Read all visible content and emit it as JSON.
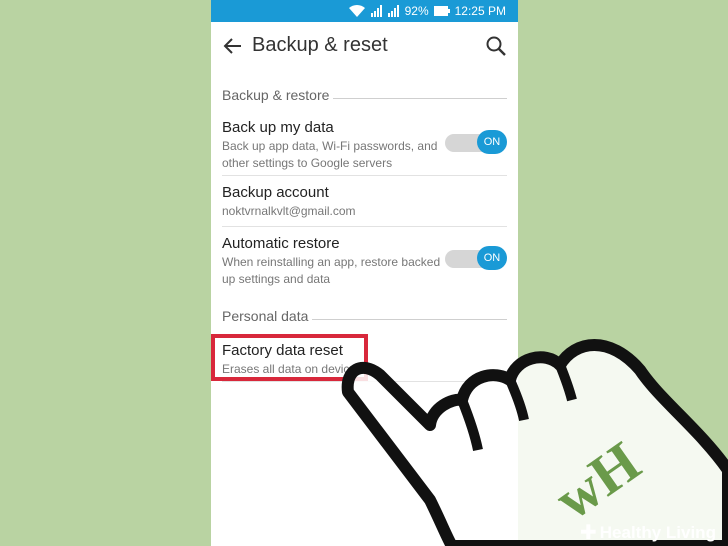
{
  "status_bar": {
    "battery": "92%",
    "time": "12:25 PM"
  },
  "app_bar": {
    "title": "Backup & reset"
  },
  "sections": {
    "backup_restore": "Backup & restore",
    "personal_data": "Personal data"
  },
  "items": {
    "back_up_my_data": {
      "title": "Back up my data",
      "subtitle": "Back up app data, Wi-Fi passwords, and other settings to Google servers",
      "toggle": "ON"
    },
    "backup_account": {
      "title": "Backup account",
      "subtitle": "noktvrnalkvlt@gmail.com"
    },
    "automatic_restore": {
      "title": "Automatic restore",
      "subtitle": "When reinstalling an app, restore backed up settings and data",
      "toggle": "ON"
    },
    "factory_data_reset": {
      "title": "Factory data reset",
      "subtitle": "Erases all data on device"
    }
  },
  "watermark": {
    "brand": "Healthy Living"
  },
  "colors": {
    "accent": "#1a9ad6",
    "highlight": "#d8283b",
    "background": "#b9d3a2"
  },
  "icons": [
    "wifi-icon",
    "sim-signal-icon",
    "sim-signal-icon",
    "battery-icon",
    "back-arrow-icon",
    "search-icon",
    "hand-pointer-icon",
    "wikihow-logo-icon"
  ]
}
